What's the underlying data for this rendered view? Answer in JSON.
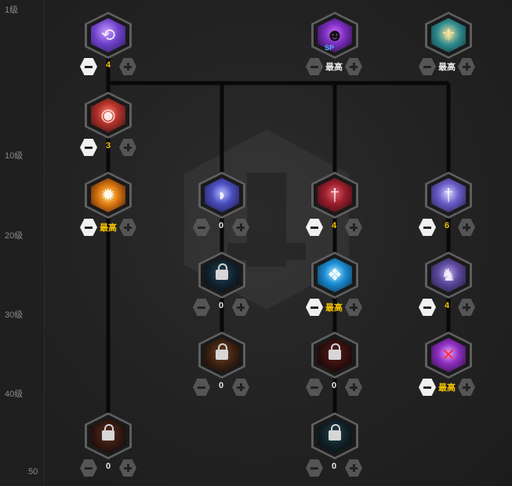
{
  "levels": [
    "1级",
    "10级",
    "20级",
    "30级",
    "40级",
    "50"
  ],
  "nodes": {
    "n1": {
      "icon": "purple-swirl-skill-icon",
      "color": "#6b3fc7",
      "value": "4"
    },
    "n2": {
      "icon": "red-orb-skill-icon",
      "color": "#b5332b",
      "value": "3"
    },
    "n3": {
      "icon": "fire-burst-skill-icon",
      "color": "#e07b12",
      "value": "最高"
    },
    "n4": {
      "icon": "dark-sp-summon-icon",
      "color": "#7b2fbf",
      "value": "最高",
      "badge": "SP"
    },
    "n5": {
      "icon": "golden-emblem-icon",
      "color": "#2d8a8f",
      "value": "最高"
    },
    "n6": {
      "icon": "violet-slash-icon",
      "color": "#4b4fbf",
      "value": "0"
    },
    "n7": {
      "icon": "crimson-sword-icon",
      "color": "#9b1e2c",
      "value": "4"
    },
    "n8": {
      "icon": "sword-of-light-icon",
      "color": "#6a5ec9",
      "value": "6"
    },
    "n9": {
      "icon": "locked-skill-icon",
      "color": "#1f3d52",
      "value": "0"
    },
    "n10": {
      "icon": "ice-crystal-icon",
      "color": "#1c8fd6",
      "value": "最高"
    },
    "n11": {
      "icon": "armored-warrior-icon",
      "color": "#5d4a9e",
      "value": "4"
    },
    "n12": {
      "icon": "locked-skill-icon",
      "color": "#6b3a1e",
      "value": "0"
    },
    "n13": {
      "icon": "locked-skill-icon",
      "color": "#5a1a1a",
      "value": "0"
    },
    "n14": {
      "icon": "crossed-star-icon",
      "color": "#8e2fc2",
      "value": "最高"
    },
    "n15": {
      "icon": "locked-skill-icon",
      "color": "#5a2a1e",
      "value": "0"
    },
    "n16": {
      "icon": "locked-skill-icon",
      "color": "#1e3a45",
      "value": "0"
    }
  },
  "colors": {
    "gold": "#f5c400",
    "wire": "#0a0a0a"
  }
}
